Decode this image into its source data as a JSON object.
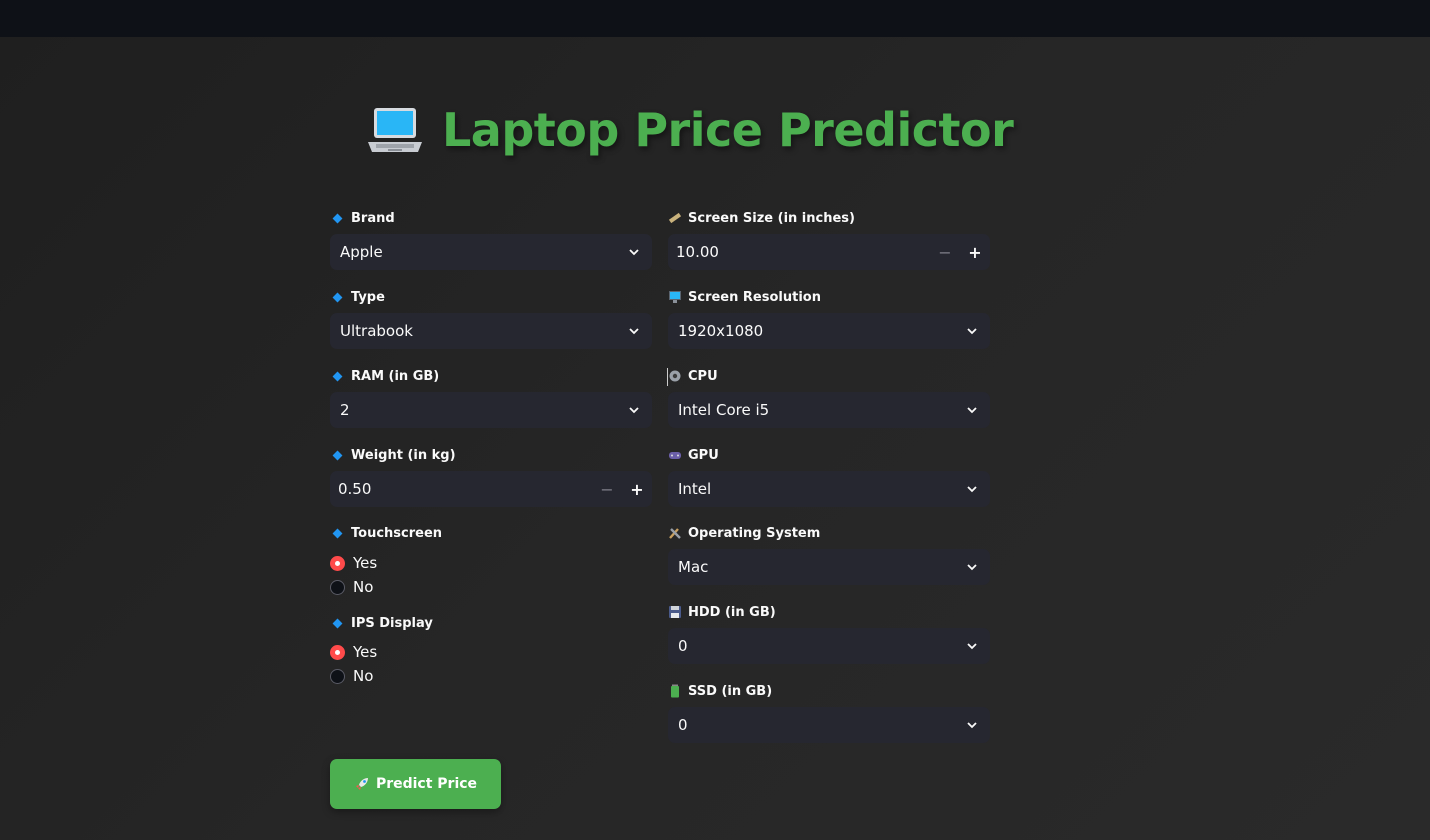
{
  "header": {
    "title": "Laptop Price Predictor",
    "icon": "laptop-icon"
  },
  "left": {
    "brand": {
      "label": "Brand",
      "value": "Apple"
    },
    "type": {
      "label": "Type",
      "value": "Ultrabook"
    },
    "ram": {
      "label": "RAM (in GB)",
      "value": "2"
    },
    "weight": {
      "label": "Weight (in kg)",
      "value": "0.50",
      "minus": "−",
      "plus": "+"
    },
    "touchscreen": {
      "label": "Touchscreen",
      "options": [
        "Yes",
        "No"
      ],
      "selected": "Yes"
    },
    "ips": {
      "label": "IPS Display",
      "options": [
        "Yes",
        "No"
      ],
      "selected": "Yes"
    }
  },
  "right": {
    "screen_size": {
      "label": "Screen Size (in inches)",
      "value": "10.00",
      "minus": "−",
      "plus": "+"
    },
    "resolution": {
      "label": "Screen Resolution",
      "value": "1920x1080"
    },
    "cpu": {
      "label": "CPU",
      "value": "Intel Core i5"
    },
    "gpu": {
      "label": "GPU",
      "value": "Intel"
    },
    "os": {
      "label": "Operating System",
      "value": "Mac"
    },
    "hdd": {
      "label": "HDD (in GB)",
      "value": "0"
    },
    "ssd": {
      "label": "SSD (in GB)",
      "value": "0"
    }
  },
  "actions": {
    "predict_label": "Predict Price"
  },
  "colors": {
    "accent": "#4caf50",
    "radio_selected": "#ff4b4b",
    "diamond": "#2196f3",
    "input_bg": "#262730"
  }
}
